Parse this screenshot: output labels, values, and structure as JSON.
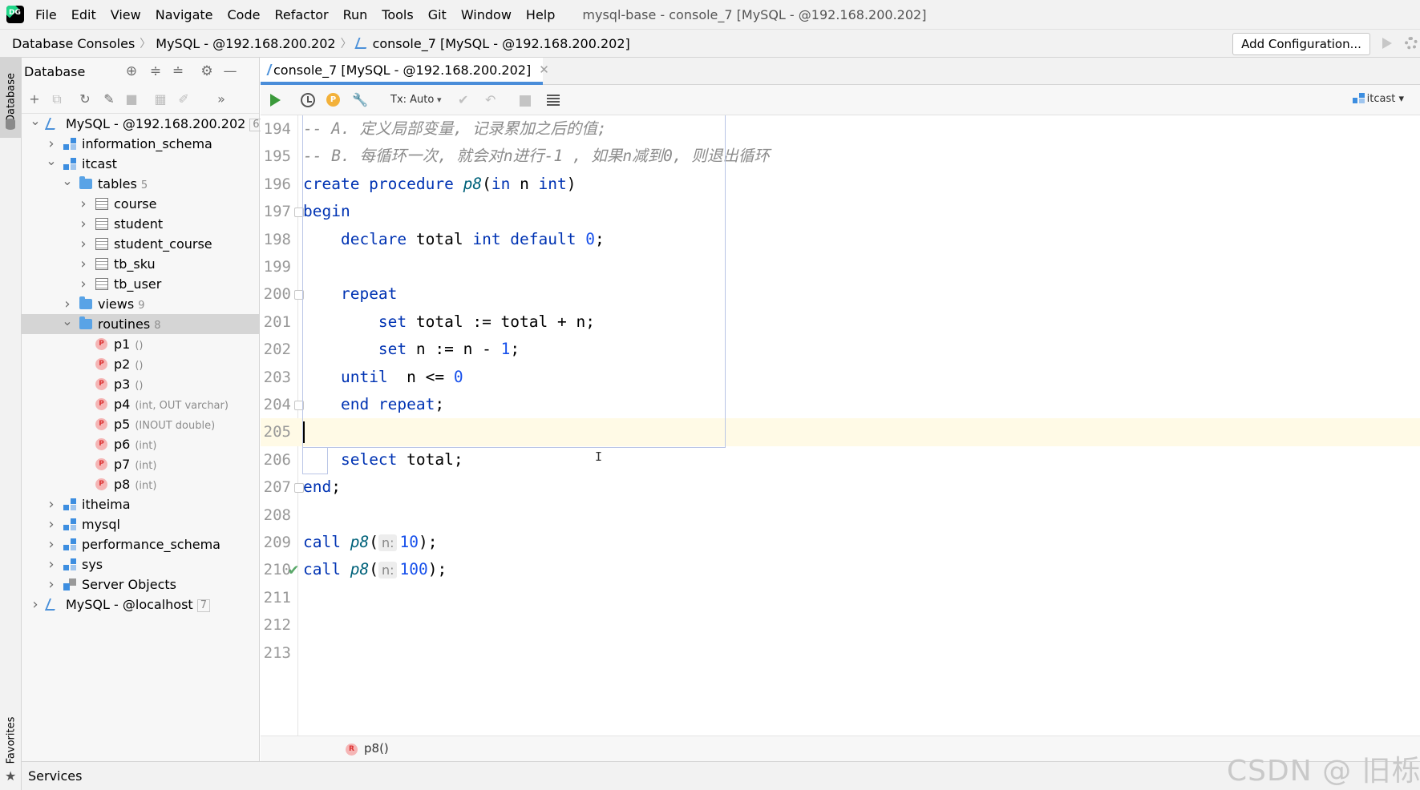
{
  "menubar": {
    "items": [
      "File",
      "Edit",
      "View",
      "Navigate",
      "Code",
      "Refactor",
      "Run",
      "Tools",
      "Git",
      "Window",
      "Help"
    ],
    "window_title": "mysql-base - console_7 [MySQL - @192.168.200.202]"
  },
  "navbar": {
    "crumbs": [
      "Database Consoles",
      "MySQL - @192.168.200.202",
      "console_7 [MySQL - @192.168.200.202]"
    ],
    "add_configuration": "Add Configuration..."
  },
  "left_strip": {
    "database": "Database",
    "favorites": "Favorites"
  },
  "db_panel": {
    "title": "Database",
    "tree": [
      {
        "label": "MySQL - @192.168.200.202",
        "count": "6",
        "level": 0,
        "icon": "server-icon",
        "chevron": "down"
      },
      {
        "label": "information_schema",
        "level": 1,
        "icon": "schema-icon",
        "chevron": "right"
      },
      {
        "label": "itcast",
        "level": 1,
        "icon": "schema-icon",
        "chevron": "down"
      },
      {
        "label": "tables",
        "count": "5",
        "level": 2,
        "icon": "folder-icon",
        "chevron": "down"
      },
      {
        "label": "course",
        "level": 3,
        "icon": "table-icon",
        "chevron": "right"
      },
      {
        "label": "student",
        "level": 3,
        "icon": "table-icon",
        "chevron": "right"
      },
      {
        "label": "student_course",
        "level": 3,
        "icon": "table-icon",
        "chevron": "right"
      },
      {
        "label": "tb_sku",
        "level": 3,
        "icon": "table-icon",
        "chevron": "right"
      },
      {
        "label": "tb_user",
        "level": 3,
        "icon": "table-icon",
        "chevron": "right"
      },
      {
        "label": "views",
        "count": "9",
        "level": 2,
        "icon": "folder-icon",
        "chevron": "right"
      },
      {
        "label": "routines",
        "count": "8",
        "level": 2,
        "icon": "folder-icon",
        "chevron": "down",
        "selected": true
      },
      {
        "label": "p1",
        "sig": "()",
        "level": 3,
        "icon": "procedure-icon"
      },
      {
        "label": "p2",
        "sig": "()",
        "level": 3,
        "icon": "procedure-icon"
      },
      {
        "label": "p3",
        "sig": "()",
        "level": 3,
        "icon": "procedure-icon"
      },
      {
        "label": "p4",
        "sig": "(int, OUT varchar)",
        "level": 3,
        "icon": "procedure-icon"
      },
      {
        "label": "p5",
        "sig": "(INOUT double)",
        "level": 3,
        "icon": "procedure-icon"
      },
      {
        "label": "p6",
        "sig": "(int)",
        "level": 3,
        "icon": "procedure-icon"
      },
      {
        "label": "p7",
        "sig": "(int)",
        "level": 3,
        "icon": "procedure-icon"
      },
      {
        "label": "p8",
        "sig": "(int)",
        "level": 3,
        "icon": "procedure-icon"
      },
      {
        "label": "itheima",
        "level": 1,
        "icon": "schema-icon",
        "chevron": "right"
      },
      {
        "label": "mysql",
        "level": 1,
        "icon": "schema-icon",
        "chevron": "right"
      },
      {
        "label": "performance_schema",
        "level": 1,
        "icon": "schema-icon",
        "chevron": "right"
      },
      {
        "label": "sys",
        "level": 1,
        "icon": "schema-icon",
        "chevron": "right"
      },
      {
        "label": "Server Objects",
        "level": 1,
        "icon": "server-objects-icon",
        "chevron": "right"
      },
      {
        "label": "MySQL - @localhost",
        "count": "7",
        "level": 0,
        "icon": "server-icon",
        "chevron": "right"
      }
    ]
  },
  "editor": {
    "tab_label": "console_7 [MySQL - @192.168.200.202]",
    "tx_mode": "Tx: Auto",
    "schema": "itcast",
    "lines": [
      {
        "n": "194",
        "tokens": [
          [
            "cm",
            "-- A. 定义局部变量, 记录累加之后的值;"
          ]
        ]
      },
      {
        "n": "195",
        "tokens": [
          [
            "cm",
            "-- B. 每循环一次, 就会对n进行-1 , 如果n减到0, 则退出循环"
          ]
        ]
      },
      {
        "n": "196",
        "tokens": [
          [
            "kw",
            "create procedure "
          ],
          [
            "fn",
            "p8"
          ],
          [
            "t",
            "("
          ],
          [
            "kw",
            "in "
          ],
          [
            "t",
            "n "
          ],
          [
            "kw",
            "int"
          ],
          [
            "t",
            ")"
          ]
        ]
      },
      {
        "n": "197",
        "fold": true,
        "tokens": [
          [
            "kw",
            "begin"
          ]
        ]
      },
      {
        "n": "198",
        "tokens": [
          [
            "t",
            "    "
          ],
          [
            "kw",
            "declare "
          ],
          [
            "t",
            "total "
          ],
          [
            "kw",
            "int default "
          ],
          [
            "num",
            "0"
          ],
          [
            "t",
            ";"
          ]
        ]
      },
      {
        "n": "199",
        "tokens": []
      },
      {
        "n": "200",
        "fold": true,
        "tokens": [
          [
            "t",
            "    "
          ],
          [
            "kw",
            "repeat"
          ]
        ]
      },
      {
        "n": "201",
        "tokens": [
          [
            "t",
            "        "
          ],
          [
            "kw",
            "set "
          ],
          [
            "t",
            "total := total + n;"
          ]
        ]
      },
      {
        "n": "202",
        "tokens": [
          [
            "t",
            "        "
          ],
          [
            "kw",
            "set "
          ],
          [
            "t",
            "n := n - "
          ],
          [
            "num",
            "1"
          ],
          [
            "t",
            ";"
          ]
        ]
      },
      {
        "n": "203",
        "tokens": [
          [
            "t",
            "    "
          ],
          [
            "kw",
            "until  "
          ],
          [
            "t",
            "n <= "
          ],
          [
            "num",
            "0"
          ]
        ]
      },
      {
        "n": "204",
        "fold": true,
        "tokens": [
          [
            "t",
            "    "
          ],
          [
            "kw",
            "end repeat"
          ],
          [
            "t",
            ";"
          ]
        ]
      },
      {
        "n": "205",
        "current": true,
        "tokens": []
      },
      {
        "n": "206",
        "tokens": [
          [
            "t",
            "    "
          ],
          [
            "kw",
            "select "
          ],
          [
            "t",
            "total;"
          ]
        ]
      },
      {
        "n": "207",
        "fold": true,
        "tokens": [
          [
            "kw",
            "end"
          ],
          [
            "t",
            ";"
          ]
        ]
      },
      {
        "n": "208",
        "tokens": []
      },
      {
        "n": "209",
        "tokens": [
          [
            "kw",
            "call "
          ],
          [
            "fn",
            "p8"
          ],
          [
            "t",
            "("
          ],
          [
            "hint",
            "n:"
          ],
          [
            "num",
            "10"
          ],
          [
            "t",
            ");"
          ]
        ]
      },
      {
        "n": "210",
        "tokens": [
          [
            "kw",
            "call "
          ],
          [
            "fn",
            "p8"
          ],
          [
            "t",
            "("
          ],
          [
            "hint",
            "n:"
          ],
          [
            "num",
            "100"
          ],
          [
            "t",
            ");"
          ]
        ]
      },
      {
        "n": "211",
        "tokens": []
      },
      {
        "n": "212",
        "tokens": []
      },
      {
        "n": "213",
        "tokens": []
      }
    ],
    "breadcrumb": "p8()"
  },
  "bottom": {
    "services": "Services"
  },
  "watermark": "CSDN @ 旧栎",
  "colors": {
    "keyword": "#0033b3",
    "number": "#1750eb",
    "comment": "#8c8c8c",
    "tab_accent": "#4a8dd9"
  }
}
